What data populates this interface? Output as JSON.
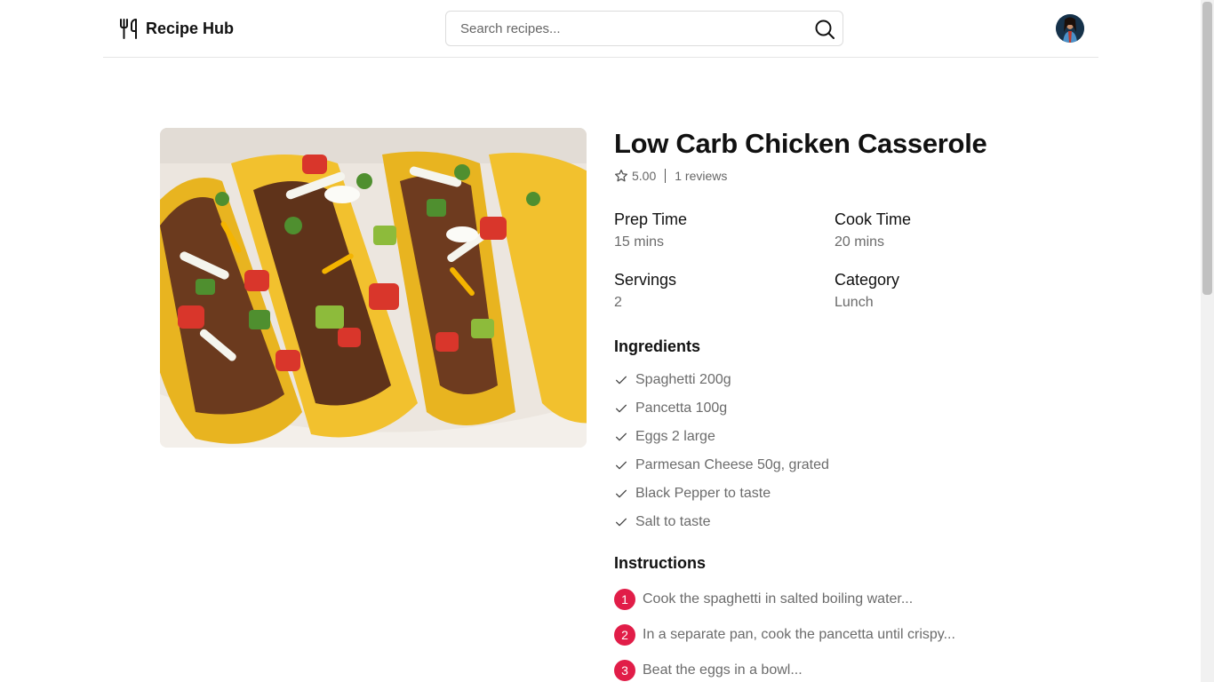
{
  "header": {
    "brand_name": "Recipe Hub",
    "search": {
      "placeholder": "Search recipes...",
      "value": ""
    }
  },
  "recipe": {
    "title": "Low Carb Chicken Casserole",
    "rating": "5.00",
    "reviews": "1 reviews",
    "meta": {
      "prep_time": {
        "label": "Prep Time",
        "value": "15 mins"
      },
      "cook_time": {
        "label": "Cook Time",
        "value": "20 mins"
      },
      "servings": {
        "label": "Servings",
        "value": "2"
      },
      "category": {
        "label": "Category",
        "value": "Lunch"
      }
    },
    "ingredients_title": "Ingredients",
    "ingredients": [
      "Spaghetti 200g",
      "Pancetta 100g",
      "Eggs 2 large",
      "Parmesan Cheese 50g, grated",
      "Black Pepper to taste",
      "Salt to taste"
    ],
    "instructions_title": "Instructions",
    "instructions": [
      {
        "num": "1",
        "text": "Cook the spaghetti in salted boiling water..."
      },
      {
        "num": "2",
        "text": "In a separate pan, cook the pancetta until crispy..."
      },
      {
        "num": "3",
        "text": "Beat the eggs in a bowl..."
      }
    ]
  },
  "icons": {
    "brand": "utensils-icon",
    "search": "search-icon",
    "rating": "star-outline-icon",
    "ingredient": "check-icon"
  },
  "colors": {
    "accent": "#e11d48",
    "text_primary": "#111111",
    "text_muted": "#6b6b6b",
    "border": "#e5e5e5"
  }
}
